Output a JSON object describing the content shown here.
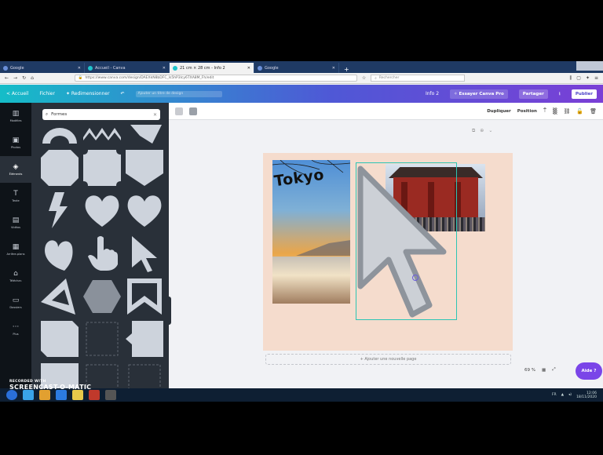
{
  "browser": {
    "tabs": [
      {
        "label": "Google",
        "active": false
      },
      {
        "label": "Accueil - Canva",
        "active": false
      },
      {
        "label": "21 cm × 28 cm - Info 2",
        "active": true
      },
      {
        "label": "Google",
        "active": false
      }
    ],
    "new_tab": "+",
    "url": "https://www.canva.com/design/DAEXkN8bDFC_ls5hP3lcy6TXA8M_Fh/edit",
    "search_placeholder": "Rechercher"
  },
  "canva": {
    "home": "< Accueil",
    "file": "Fichier",
    "resize": "✦ Redimensionner",
    "undo": "↶",
    "doc_title_placeholder": "Ajouter un titre de design",
    "info": "Info 2",
    "upgrade": "✧ Essayer Canva Pro",
    "share": "Partager",
    "download": "⭳",
    "publish": "Publier"
  },
  "rail": [
    {
      "icon": "▥",
      "label": "Modèles",
      "name": "templates",
      "active": false
    },
    {
      "icon": "▣",
      "label": "Photos",
      "name": "photos",
      "active": false
    },
    {
      "icon": "◈",
      "label": "Éléments",
      "name": "elements",
      "active": true
    },
    {
      "icon": "T",
      "label": "Texte",
      "name": "text",
      "active": false
    },
    {
      "icon": "▤",
      "label": "Vidéos",
      "name": "videos",
      "active": false
    },
    {
      "icon": "▦",
      "label": "Arrière-plans",
      "name": "backgrounds",
      "active": false
    },
    {
      "icon": "⌂",
      "label": "Téléchar.",
      "name": "uploads",
      "active": false
    },
    {
      "icon": "▭",
      "label": "Dossiers",
      "name": "folders",
      "active": false
    },
    {
      "icon": "···",
      "label": "Plus",
      "name": "more",
      "active": false
    }
  ],
  "panel": {
    "search_value": "Formes",
    "clear": "✕"
  },
  "toolbar": {
    "duplicate": "Dupliquer",
    "position": "Position"
  },
  "editor": {
    "tokyo_text": "Tokyo",
    "add_page": "+ Ajouter une nouvelle page",
    "zoom": "69 %",
    "help": "Aide ?"
  },
  "taskbar": {
    "time": "12:06",
    "date": "18/11/2020"
  },
  "watermark": {
    "top": "RECORDED WITH",
    "main": "SCREENCAST-O-MATIC"
  },
  "colors": {
    "selection": "#2cc5b4",
    "canva_purple": "#7a45e8",
    "page_bg": "#f5dccd"
  }
}
